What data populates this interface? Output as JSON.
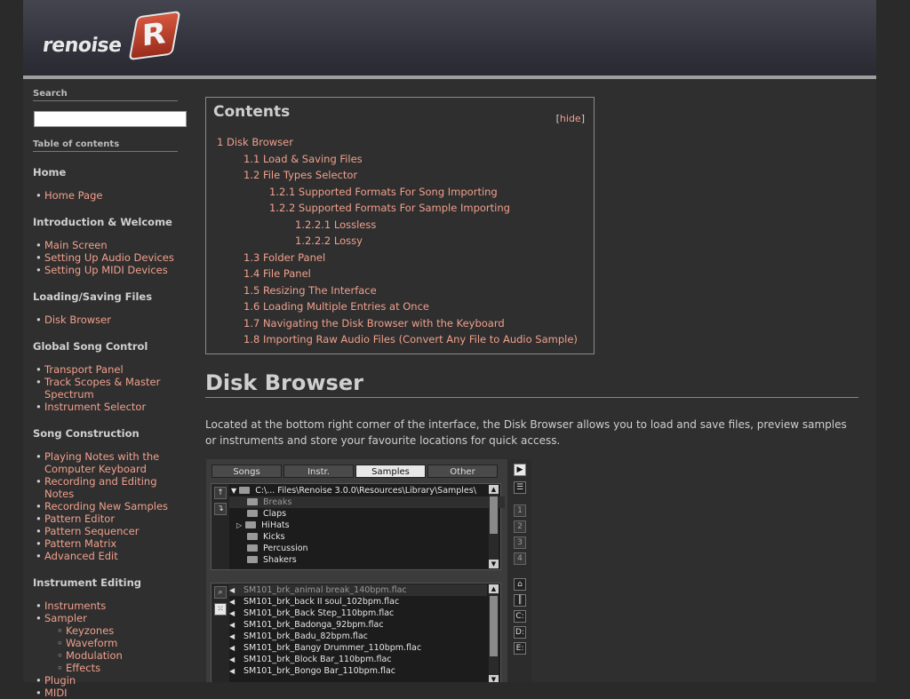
{
  "brand": {
    "name": "renoise",
    "badge_letter": "R"
  },
  "sidebar": {
    "search_heading": "Search",
    "search_placeholder": "",
    "toc_heading": "Table of contents",
    "sections": [
      {
        "title": "Home",
        "items": [
          {
            "label": "Home Page"
          }
        ]
      },
      {
        "title": "Introduction & Welcome",
        "items": [
          {
            "label": "Main Screen"
          },
          {
            "label": "Setting Up Audio Devices"
          },
          {
            "label": "Setting Up MIDI Devices"
          }
        ]
      },
      {
        "title": "Loading/Saving Files",
        "items": [
          {
            "label": "Disk Browser"
          }
        ]
      },
      {
        "title": "Global Song Control",
        "items": [
          {
            "label": "Transport Panel"
          },
          {
            "label": "Track Scopes & Master Spectrum"
          },
          {
            "label": "Instrument Selector"
          }
        ]
      },
      {
        "title": "Song Construction",
        "items": [
          {
            "label": "Playing Notes with the Computer Keyboard"
          },
          {
            "label": "Recording and Editing Notes"
          },
          {
            "label": "Recording New Samples"
          },
          {
            "label": "Pattern Editor"
          },
          {
            "label": "Pattern Sequencer"
          },
          {
            "label": "Pattern Matrix"
          },
          {
            "label": "Advanced Edit"
          }
        ]
      },
      {
        "title": "Instrument Editing",
        "items": [
          {
            "label": "Instruments"
          },
          {
            "label": "Sampler",
            "children": [
              "Keyzones",
              "Waveform",
              "Modulation",
              "Effects"
            ]
          },
          {
            "label": "Plugin"
          },
          {
            "label": "MIDI"
          }
        ]
      }
    ]
  },
  "toc": {
    "title": "Contents",
    "hide_open": "[",
    "hide_label": "hide",
    "hide_close": "]",
    "items": [
      {
        "level": 1,
        "text": "1 Disk Browser"
      },
      {
        "level": 2,
        "text": "1.1 Load & Saving Files"
      },
      {
        "level": 2,
        "text": "1.2 File Types Selector"
      },
      {
        "level": 3,
        "text": "1.2.1 Supported Formats For Song Importing"
      },
      {
        "level": 3,
        "text": "1.2.2 Supported Formats For Sample Importing"
      },
      {
        "level": 4,
        "text": "1.2.2.1 Lossless"
      },
      {
        "level": 4,
        "text": "1.2.2.2 Lossy"
      },
      {
        "level": 2,
        "text": "1.3 Folder Panel"
      },
      {
        "level": 2,
        "text": "1.4 File Panel"
      },
      {
        "level": 2,
        "text": "1.5 Resizing The Interface"
      },
      {
        "level": 2,
        "text": "1.6 Loading Multiple Entries at Once"
      },
      {
        "level": 2,
        "text": "1.7 Navigating the Disk Browser with the Keyboard"
      },
      {
        "level": 2,
        "text": "1.8 Importing Raw Audio Files (Convert Any File to Audio Sample)"
      }
    ]
  },
  "article": {
    "heading": "Disk Browser",
    "intro": "Located at the bottom right corner of the interface, the Disk Browser allows you to load and save files, preview samples or instruments and store your favourite locations for quick access."
  },
  "browser": {
    "tabs": [
      "Songs",
      "Instr.",
      "Samples",
      "Other"
    ],
    "active_tab": "Samples",
    "path": "C:\\... Files\\Renoise 3.0.0\\Resources\\Library\\Samples\\",
    "folders": [
      "Breaks",
      "Claps",
      "HiHats",
      "Kicks",
      "Percussion",
      "Shakers"
    ],
    "files": [
      "SM101_brk_animal break_140bpm.flac",
      "SM101_brk_back II soul_102bpm.flac",
      "SM101_brk_Back Step_110bpm.flac",
      "SM101_brk_Badonga_92bpm.flac",
      "SM101_brk_Badu_82bpm.flac",
      "SM101_brk_Bangy Drummer_110bpm.flac",
      "SM101_brk_Block Bar_110bpm.flac",
      "SM101_brk_Bongo Bar_110bpm.flac"
    ],
    "slots": [
      "1",
      "2",
      "3",
      "4"
    ],
    "drives": [
      "C:",
      "D:",
      "E:"
    ]
  }
}
